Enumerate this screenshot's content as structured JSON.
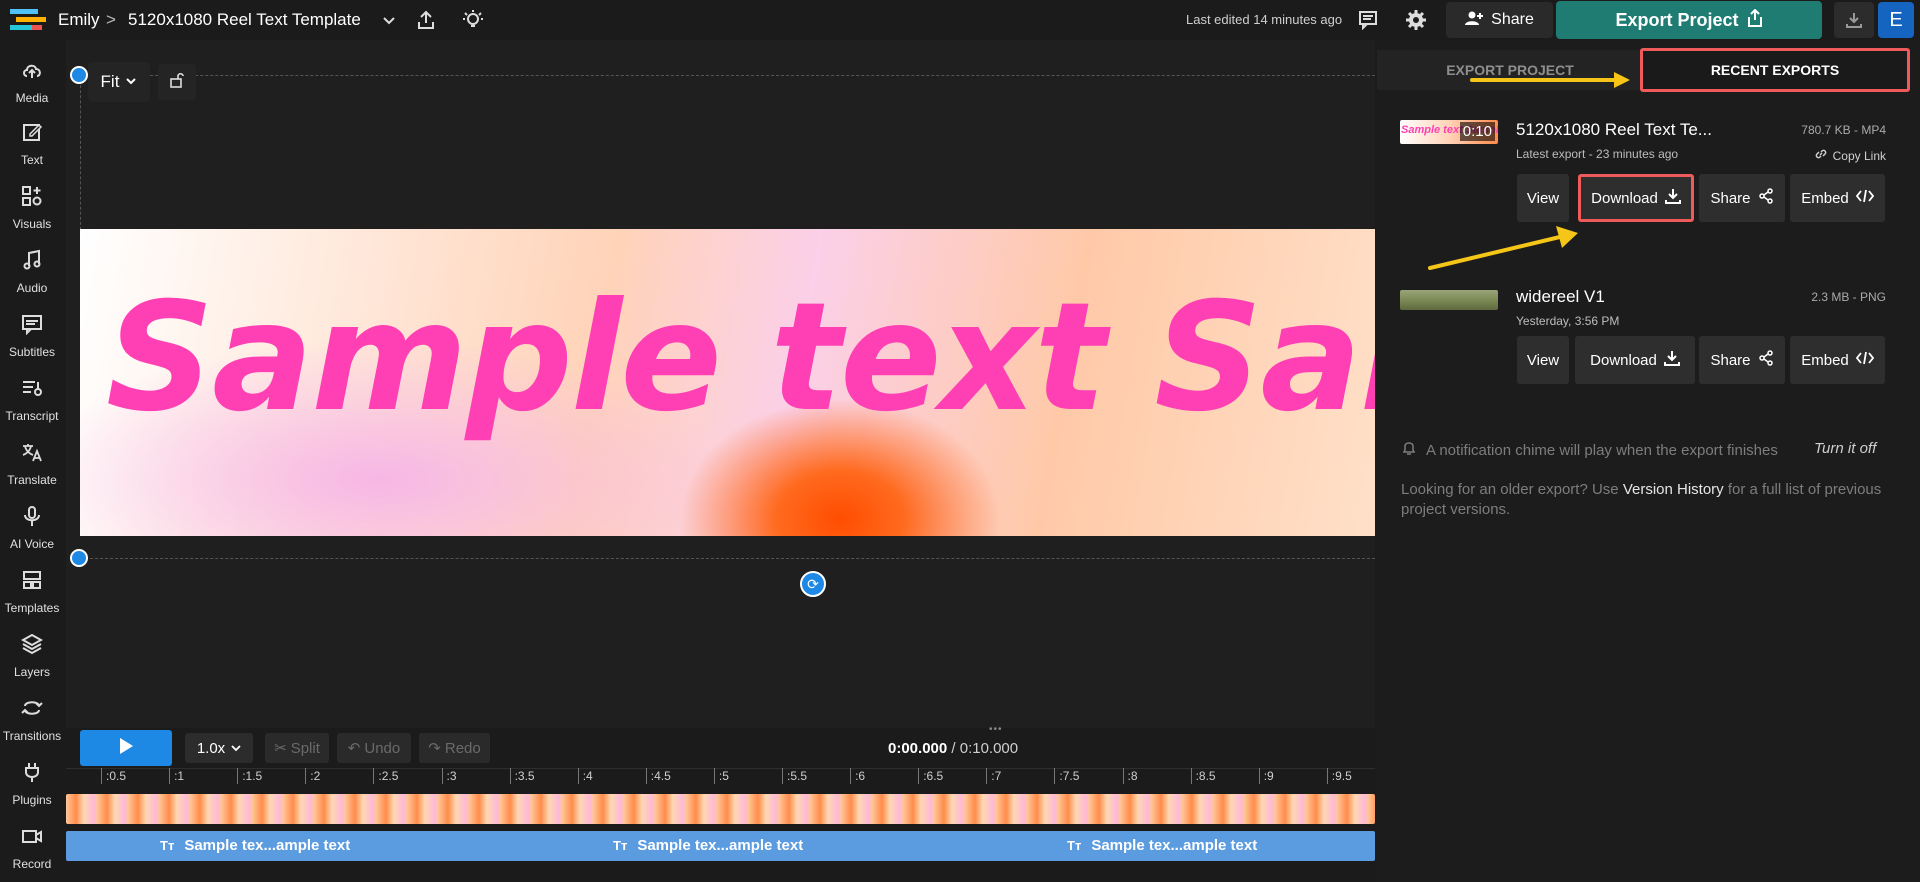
{
  "header": {
    "user": "Emily",
    "separator": ">",
    "project_title": "5120x1080 Reel Text Template",
    "last_edited": "Last edited 14 minutes ago",
    "share_label": "Share",
    "export_label": "Export Project",
    "avatar_initial": "E"
  },
  "sidebar": {
    "items": [
      {
        "label": "Media",
        "icon": "upload-cloud-icon"
      },
      {
        "label": "Text",
        "icon": "pencil-square-icon"
      },
      {
        "label": "Visuals",
        "icon": "shapes-icon"
      },
      {
        "label": "Audio",
        "icon": "music-note-icon"
      },
      {
        "label": "Subtitles",
        "icon": "chat-lines-icon"
      },
      {
        "label": "Transcript",
        "icon": "transcript-icon"
      },
      {
        "label": "Translate",
        "icon": "translate-icon"
      },
      {
        "label": "AI Voice",
        "icon": "microphone-icon"
      },
      {
        "label": "Templates",
        "icon": "templates-icon"
      },
      {
        "label": "Layers",
        "icon": "layers-icon"
      },
      {
        "label": "Transitions",
        "icon": "transitions-icon"
      },
      {
        "label": "Plugins",
        "icon": "plug-icon"
      },
      {
        "label": "Record",
        "icon": "camera-icon"
      }
    ]
  },
  "canvas": {
    "zoom_label": "Fit",
    "sample_text": "Sample text Sample text"
  },
  "panel": {
    "tab_export": "EXPORT PROJECT",
    "tab_recent": "RECENT EXPORTS",
    "exports": [
      {
        "name": "5120x1080 Reel Text Te...",
        "meta": "780.7 KB - MP4",
        "sub": "Latest export - 23 minutes ago",
        "duration": "0:10",
        "copy_link": "Copy Link"
      },
      {
        "name": "widereel V1",
        "meta": "2.3 MB - PNG",
        "sub": "Yesterday, 3:56 PM"
      }
    ],
    "actions": {
      "view": "View",
      "download": "Download",
      "share": "Share",
      "embed": "Embed"
    },
    "notification": "A notification chime will play when the export finishes",
    "turn_off": "Turn it off",
    "older_prefix": "Looking for an older export? Use ",
    "older_link": "Version History",
    "older_suffix": " for a full list of previous project versions."
  },
  "controls": {
    "speed": "1.0x",
    "split": "Split",
    "undo": "Undo",
    "redo": "Redo",
    "time_current": "0:00.000",
    "time_total": " / 0:10.000"
  },
  "timeline": {
    "ticks": [
      ":0.5",
      ":1",
      ":1.5",
      ":2",
      ":2.5",
      ":3",
      ":3.5",
      ":4",
      ":4.5",
      ":5",
      ":5.5",
      ":6",
      ":6.5",
      ":7",
      ":7.5",
      ":8",
      ":8.5",
      ":9",
      ":9.5"
    ],
    "text_clip_label": "Sample tex...ample text",
    "text_clip_icon": "Tт"
  },
  "colors": {
    "accent_blue": "#1e88e5",
    "export_green": "#1f7c72",
    "highlight_red": "#ef5b5b",
    "annotation_yellow": "#f5c518",
    "sample_text_pink": "#ff40b4"
  }
}
